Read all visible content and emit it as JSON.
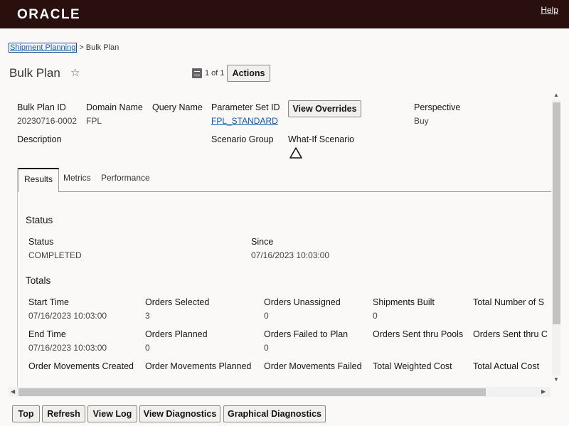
{
  "header": {
    "logo": "ORACLE",
    "help": "Help"
  },
  "breadcrumb": {
    "parent": "Shipment Planning",
    "separator": ">",
    "current": "Bulk Plan"
  },
  "title": {
    "text": "Bulk Plan",
    "star": "☆",
    "pager": "1 of 1",
    "actions": "Actions"
  },
  "details": {
    "bulk_plan_id_label": "Bulk Plan ID",
    "bulk_plan_id": "20230716-0002",
    "domain_name_label": "Domain Name",
    "domain_name": "FPL",
    "query_name_label": "Query Name",
    "parameter_set_id_label": "Parameter Set ID",
    "parameter_set_id": "FPL_STANDARD",
    "view_overrides": "View Overrides",
    "perspective_label": "Perspective",
    "perspective": "Buy",
    "description_label": "Description",
    "scenario_group_label": "Scenario Group",
    "what_if_label": "What-If Scenario"
  },
  "tabs": [
    {
      "label": "Results"
    },
    {
      "label": "Metrics"
    },
    {
      "label": "Performance"
    }
  ],
  "status_section": {
    "heading": "Status",
    "status_label": "Status",
    "status": "COMPLETED",
    "since_label": "Since",
    "since": "07/16/2023 10:03:00"
  },
  "totals": {
    "heading": "Totals",
    "start_time_label": "Start Time",
    "start_time": "07/16/2023 10:03:00",
    "orders_selected_label": "Orders Selected",
    "orders_selected": "3",
    "orders_unassigned_label": "Orders Unassigned",
    "orders_unassigned": "0",
    "shipments_built_label": "Shipments Built",
    "shipments_built": "0",
    "total_number_label": "Total Number of S",
    "end_time_label": "End Time",
    "end_time": "07/16/2023 10:03:00",
    "orders_planned_label": "Orders Planned",
    "orders_planned": "0",
    "orders_failed_label": "Orders Failed to Plan",
    "orders_failed": "0",
    "orders_sent_pools_label": "Orders Sent thru Pools",
    "orders_sent_c_label": "Orders Sent thru C",
    "om_created_label": "Order Movements Created",
    "om_planned_label": "Order Movements Planned",
    "om_failed_label": "Order Movements Failed",
    "total_weighted_cost_label": "Total Weighted Cost",
    "total_actual_cost_label": "Total Actual Cost"
  },
  "footer": {
    "top": "Top",
    "refresh": "Refresh",
    "view_log": "View Log",
    "view_diagnostics": "View Diagnostics",
    "graphical_diagnostics": "Graphical Diagnostics"
  }
}
